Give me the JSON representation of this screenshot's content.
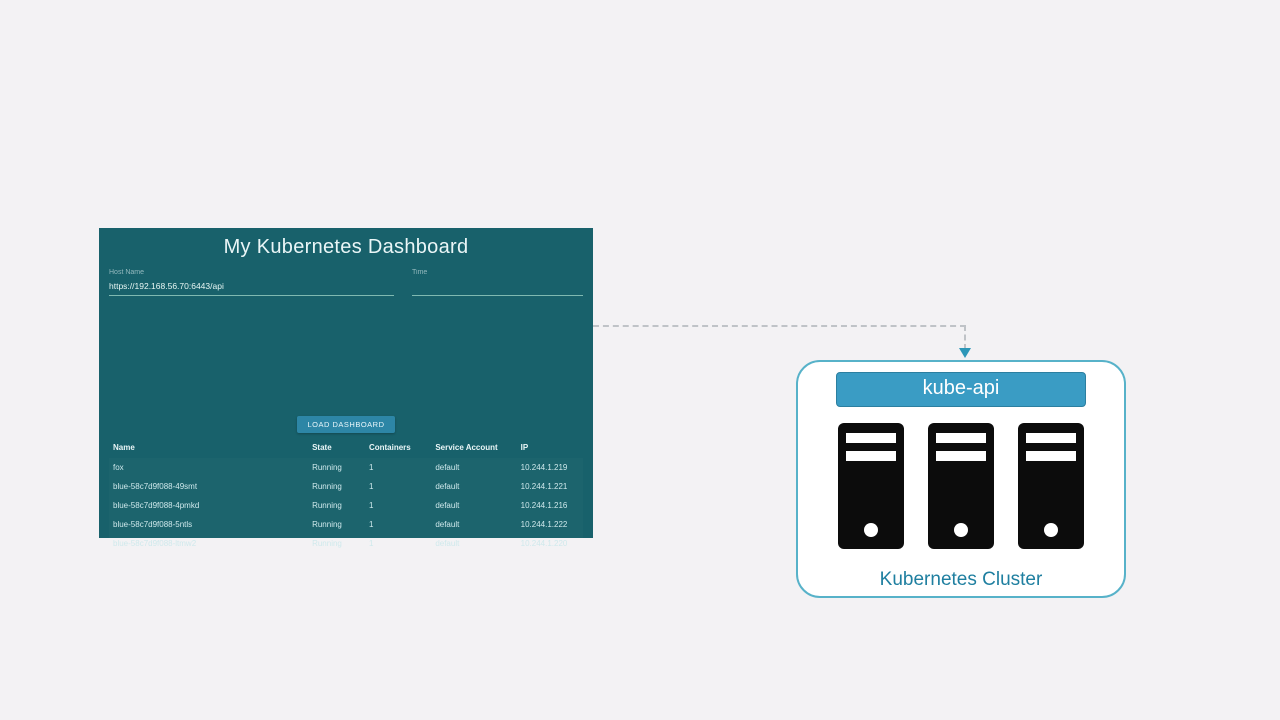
{
  "dashboard": {
    "title": "My Kubernetes Dashboard",
    "host_label": "Host Name",
    "host_value": "https://192.168.56.70:6443/api",
    "time_label": "Time",
    "time_value": "",
    "load_button": "LOAD DASHBOARD",
    "columns": {
      "name": "Name",
      "state": "State",
      "containers": "Containers",
      "service_account": "Service Account",
      "ip": "IP"
    },
    "rows": [
      {
        "name": "fox",
        "state": "Running",
        "containers": "1",
        "service_account": "default",
        "ip": "10.244.1.219"
      },
      {
        "name": "blue-58c7d9f088-49smt",
        "state": "Running",
        "containers": "1",
        "service_account": "default",
        "ip": "10.244.1.221"
      },
      {
        "name": "blue-58c7d9f088-4pmkd",
        "state": "Running",
        "containers": "1",
        "service_account": "default",
        "ip": "10.244.1.216"
      },
      {
        "name": "blue-58c7d9f088-5ntls",
        "state": "Running",
        "containers": "1",
        "service_account": "default",
        "ip": "10.244.1.222"
      },
      {
        "name": "blue-58c7d9f088-ltmw2",
        "state": "Running",
        "containers": "1",
        "service_account": "default",
        "ip": "10.244.1.220"
      }
    ]
  },
  "cluster": {
    "api_label": "kube-api",
    "caption": "Kubernetes Cluster",
    "node_count": 3
  }
}
